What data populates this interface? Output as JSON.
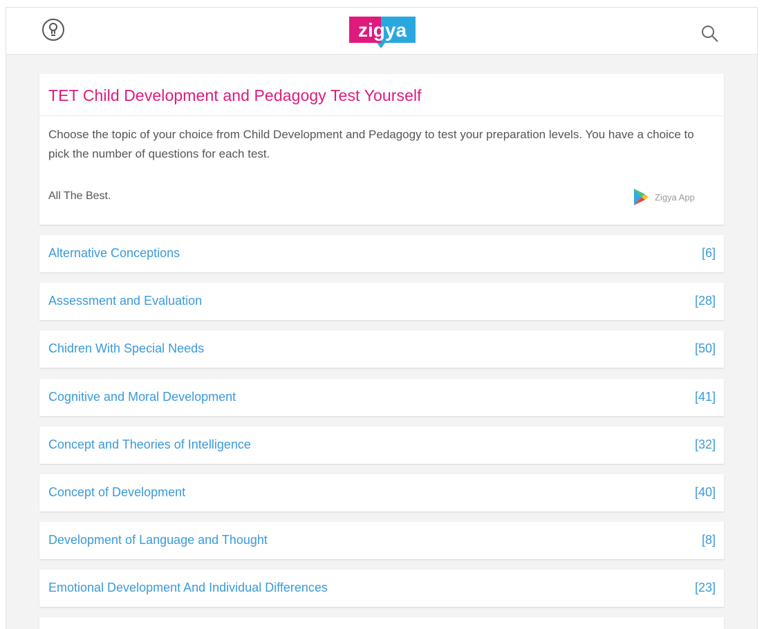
{
  "header": {
    "logo_text": "zigya",
    "colors": {
      "logo_magenta": "#e0197d",
      "logo_blue": "#29a8e0"
    },
    "icons": {
      "left": "lightbulb-icon",
      "right": "search-icon"
    }
  },
  "intro": {
    "title": "TET Child Development and Pedagogy Test Yourself",
    "description": "Choose the topic of your choice from Child Development and Pedagogy to test your preparation levels. You have a choice to pick the number of questions for each test.",
    "sign_off": "All The Best.",
    "app_label": "Zigya App",
    "app_icon": "google-play-icon"
  },
  "topics": [
    {
      "name": "Alternative Conceptions",
      "count": "[6]"
    },
    {
      "name": "Assessment and Evaluation",
      "count": "[28]"
    },
    {
      "name": "Chidren With Special Needs",
      "count": "[50]"
    },
    {
      "name": "Cognitive and Moral Development",
      "count": "[41]"
    },
    {
      "name": "Concept and Theories of Intelligence",
      "count": "[32]"
    },
    {
      "name": "Concept of Development",
      "count": "[40]"
    },
    {
      "name": "Development of Language and Thought",
      "count": "[8]"
    },
    {
      "name": "Emotional Development And Individual Differences",
      "count": "[23]"
    }
  ],
  "theme": {
    "title_color": "#e0197d",
    "link_color": "#3a9ad9",
    "background": "#f3f3f3"
  }
}
